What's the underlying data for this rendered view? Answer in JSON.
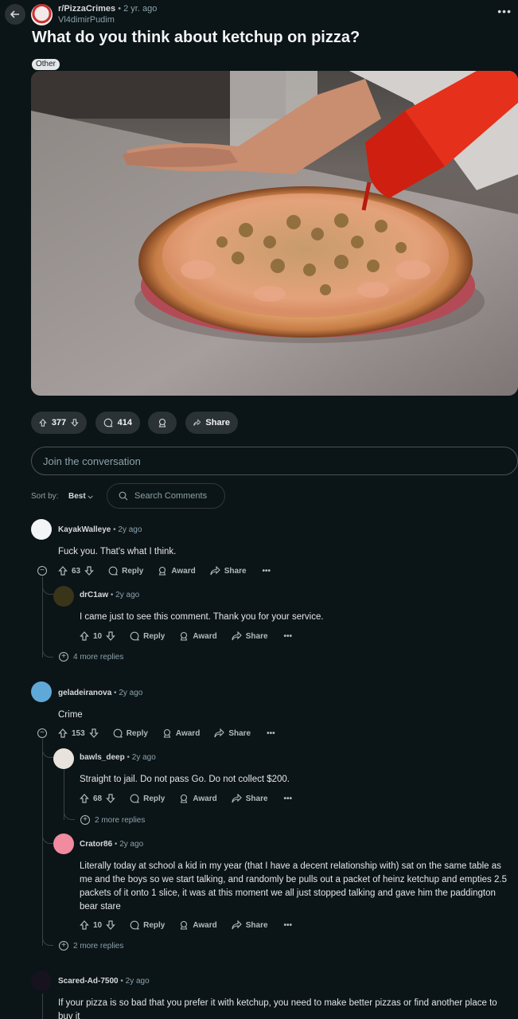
{
  "header": {
    "subreddit": "r/PizzaCrimes",
    "age": "• 2 yr. ago",
    "author": "Vl4dimirPudim",
    "menu": "•••"
  },
  "post": {
    "title": "What do you think about ketchup on pizza?",
    "flair": "Other",
    "votes": "377",
    "comments": "414",
    "share": "Share"
  },
  "composer": {
    "placeholder": "Join the conversation"
  },
  "sort": {
    "label": "Sort by:",
    "value": "Best",
    "search_placeholder": "Search Comments"
  },
  "labels": {
    "reply": "Reply",
    "award": "Award",
    "share": "Share",
    "more": "•••"
  },
  "comments": [
    {
      "user": "KayakWalleye",
      "age": "• 2y ago",
      "text": "Fuck you. That's what I think.",
      "votes": "63"
    },
    {
      "user": "drC1aw",
      "age": "• 2y ago",
      "text": "I came just to see this comment. Thank you for your service.",
      "votes": "10",
      "more": "4 more replies"
    },
    {
      "user": "geladeiranova",
      "age": "• 2y ago",
      "text": "Crime",
      "votes": "153"
    },
    {
      "user": "bawls_deep",
      "age": "• 2y ago",
      "text": "Straight to jail. Do not pass Go. Do not collect $200.",
      "votes": "68",
      "more": "2 more replies"
    },
    {
      "user": "Crator86",
      "age": "• 2y ago",
      "text": "Literally today at school a kid in my year (that I have a decent relationship with) sat on the same table as me and the boys so we start talking, and randomly be pulls out a packet of heinz ketchup and empties 2.5 packets of it onto 1 slice, it was at this moment we all just stopped talking and gave him the paddington bear stare",
      "votes": "10",
      "more": "2 more replies"
    },
    {
      "user": "Scared-Ad-7500",
      "age": "• 2y ago",
      "text": "If your pizza is so bad that you prefer it with ketchup, you need to make better pizzas or find another place to buy it"
    }
  ]
}
